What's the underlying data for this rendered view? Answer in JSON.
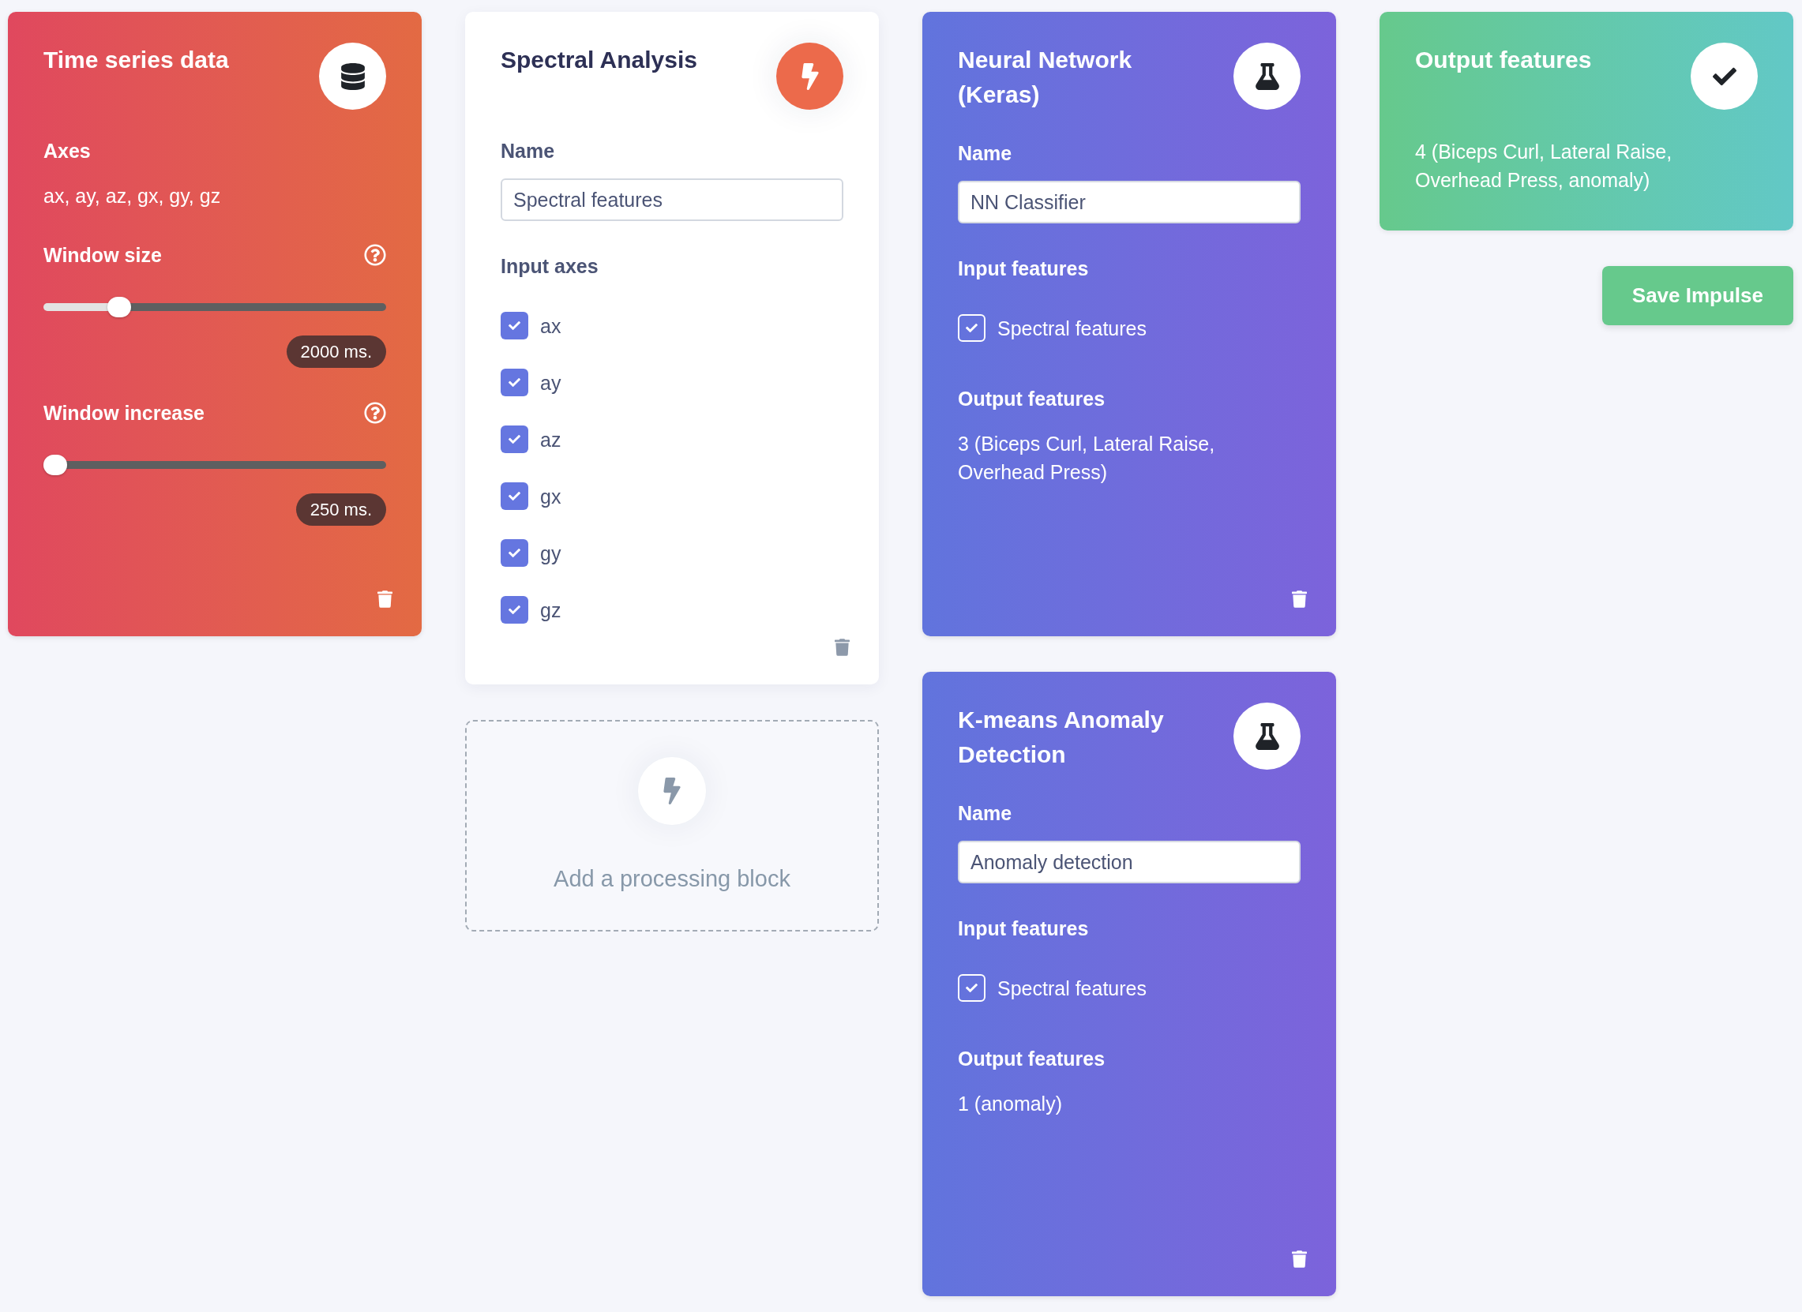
{
  "columns": [
    {
      "items": [
        {
          "kind": "input",
          "title": "Time series data",
          "sections": [
            {
              "kind": "text",
              "label": "Axes",
              "value": "ax, ay, az, gx, gy, gz"
            },
            {
              "kind": "slider",
              "label": "Window size",
              "level": 0.2,
              "reading": "2000 ms."
            },
            {
              "kind": "slider",
              "label": "Window increase",
              "level": 0,
              "reading": "250 ms."
            }
          ]
        }
      ]
    },
    {
      "items": [
        {
          "kind": "processing",
          "title": "Spectral Analysis",
          "sections": [
            {
              "kind": "field",
              "label": "Name",
              "value": "Spectral features"
            },
            {
              "kind": "checklist",
              "label": "Input axes",
              "items": [
                {
                  "label": "ax",
                  "checked": true
                },
                {
                  "label": "ay",
                  "checked": true
                },
                {
                  "label": "az",
                  "checked": true
                },
                {
                  "label": "gx",
                  "checked": true
                },
                {
                  "label": "gy",
                  "checked": true
                },
                {
                  "label": "gz",
                  "checked": true
                }
              ]
            }
          ]
        },
        {
          "kind": "add",
          "label": "Add a processing block"
        }
      ]
    },
    {
      "items": [
        {
          "kind": "learning",
          "title": "Neural Network (Keras)",
          "sections": [
            {
              "kind": "field",
              "label": "Name",
              "value": "NN Classifier"
            },
            {
              "kind": "checklist",
              "label": "Input features",
              "items": [
                {
                  "label": "Spectral features",
                  "checked": true
                }
              ]
            },
            {
              "kind": "text",
              "label": "Output features",
              "value": "3 (Biceps Curl, Lateral Raise, Overhead Press)"
            }
          ]
        },
        {
          "kind": "learning",
          "title": "K-means Anomaly Detection",
          "sections": [
            {
              "kind": "field",
              "label": "Name",
              "value": "Anomaly detection"
            },
            {
              "kind": "checklist",
              "label": "Input features",
              "items": [
                {
                  "label": "Spectral features",
                  "checked": true
                }
              ]
            },
            {
              "kind": "text",
              "label": "Output features",
              "value": "1 (anomaly)"
            }
          ]
        }
      ]
    },
    {
      "items": [
        {
          "kind": "output",
          "title": "Output features",
          "sections": [
            {
              "kind": "note",
              "value": "4 (Biceps Curl, Lateral Raise, Overhead Press, anomaly)"
            }
          ]
        },
        {
          "kind": "save",
          "label": "Save Impulse"
        }
      ]
    }
  ]
}
